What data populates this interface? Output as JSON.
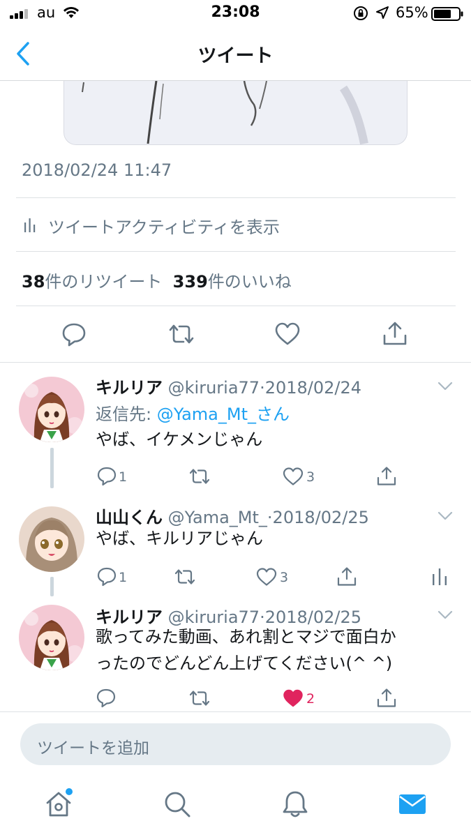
{
  "status_bar": {
    "carrier": "au",
    "time": "23:08",
    "battery": "65%",
    "icons": [
      "signal-icon",
      "wifi-icon",
      "orientation-lock-icon",
      "location-icon",
      "battery-icon"
    ]
  },
  "nav": {
    "title": "ツイート",
    "back_icon": "chevron-left-icon"
  },
  "tweet": {
    "timestamp": "2018/02/24 11:47",
    "activity_label": "ツイートアクティビティを表示",
    "retweets": {
      "count": "38",
      "label": "件のリツイート"
    },
    "likes": {
      "count": "339",
      "label": "件のいいね"
    },
    "actions": [
      "reply-icon",
      "retweet-icon",
      "like-icon",
      "share-icon"
    ]
  },
  "replies": [
    {
      "name": "キルリア",
      "handle": "@kiruria77",
      "sep": "·",
      "date": "2018/02/24",
      "reply_to_label": "返信先:",
      "reply_to_mention": "@Yama_Mt_さん",
      "text": "やば、イケメンじゃん",
      "reply_count": "1",
      "retweet_count": "",
      "like_count": "3",
      "liked": false
    },
    {
      "name": "山山くん",
      "handle": "@Yama_Mt_",
      "sep": "·",
      "date": "2018/02/25",
      "text": "やば、キルリアじゃん",
      "reply_count": "1",
      "retweet_count": "",
      "like_count": "3",
      "liked": false,
      "has_analytics": true
    },
    {
      "name": "キルリア",
      "handle": "@kiruria77",
      "sep": "·",
      "date": "2018/02/25",
      "text_line1": "歌ってみた動画、あれ割とマジで面白か",
      "text_line2": "ったのでどんどん上げてください(^ ^)",
      "reply_count": "",
      "retweet_count": "",
      "like_count": "2",
      "liked": true
    }
  ],
  "compose": {
    "placeholder": "ツイートを追加"
  },
  "tab_bar": {
    "tabs": [
      "home-icon",
      "search-icon",
      "notifications-icon",
      "messages-icon"
    ],
    "active": "messages",
    "home_has_new": true
  },
  "colors": {
    "accent": "#1da1f2",
    "like": "#e0245e",
    "secondary_text": "#657786",
    "primary_text": "#14171a"
  }
}
